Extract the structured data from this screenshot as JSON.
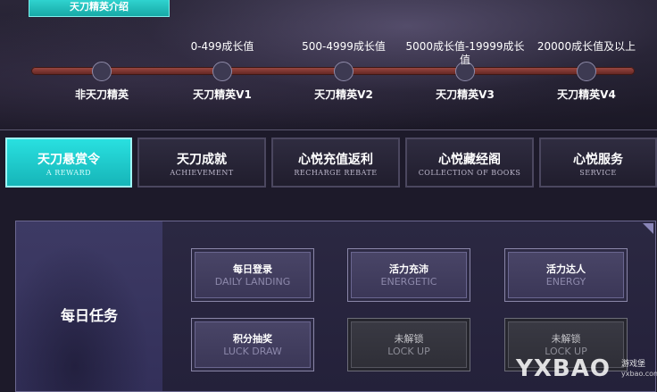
{
  "intro": {
    "label": "天刀精英介绍"
  },
  "levels": [
    {
      "name": "非天刀精英",
      "range": ""
    },
    {
      "name": "天刀精英V1",
      "range": "0-499成长值"
    },
    {
      "name": "天刀精英V2",
      "range": "500-4999成长值"
    },
    {
      "name": "天刀精英V3",
      "range": "5000成长值-19999成长值"
    },
    {
      "name": "天刀精英V4",
      "range": "20000成长值及以上"
    }
  ],
  "tabs": [
    {
      "zh": "天刀悬赏令",
      "en": "A REWARD"
    },
    {
      "zh": "天刀成就",
      "en": "ACHIEVEMENT"
    },
    {
      "zh": "心悦充值返利",
      "en": "RECHARGE REBATE"
    },
    {
      "zh": "心悦藏经阁",
      "en": "COLLECTION OF BOOKS"
    },
    {
      "zh": "心悦服务",
      "en": "SERVICE"
    }
  ],
  "panel": {
    "title": "每日任务",
    "tasks": [
      {
        "zh": "每日登录",
        "en": "DAILY LANDING",
        "locked": false
      },
      {
        "zh": "活力充沛",
        "en": "ENERGETIC",
        "locked": false
      },
      {
        "zh": "活力达人",
        "en": "ENERGY",
        "locked": false
      },
      {
        "zh": "积分抽奖",
        "en": "LUCK DRAW",
        "locked": false
      },
      {
        "zh": "未解锁",
        "en": "LOCK UP",
        "locked": true
      },
      {
        "zh": "未解锁",
        "en": "LOCK UP",
        "locked": true
      }
    ]
  },
  "watermark": {
    "logo": "YXBAO",
    "site": "游戏堡",
    "url": "yxbao.com"
  }
}
